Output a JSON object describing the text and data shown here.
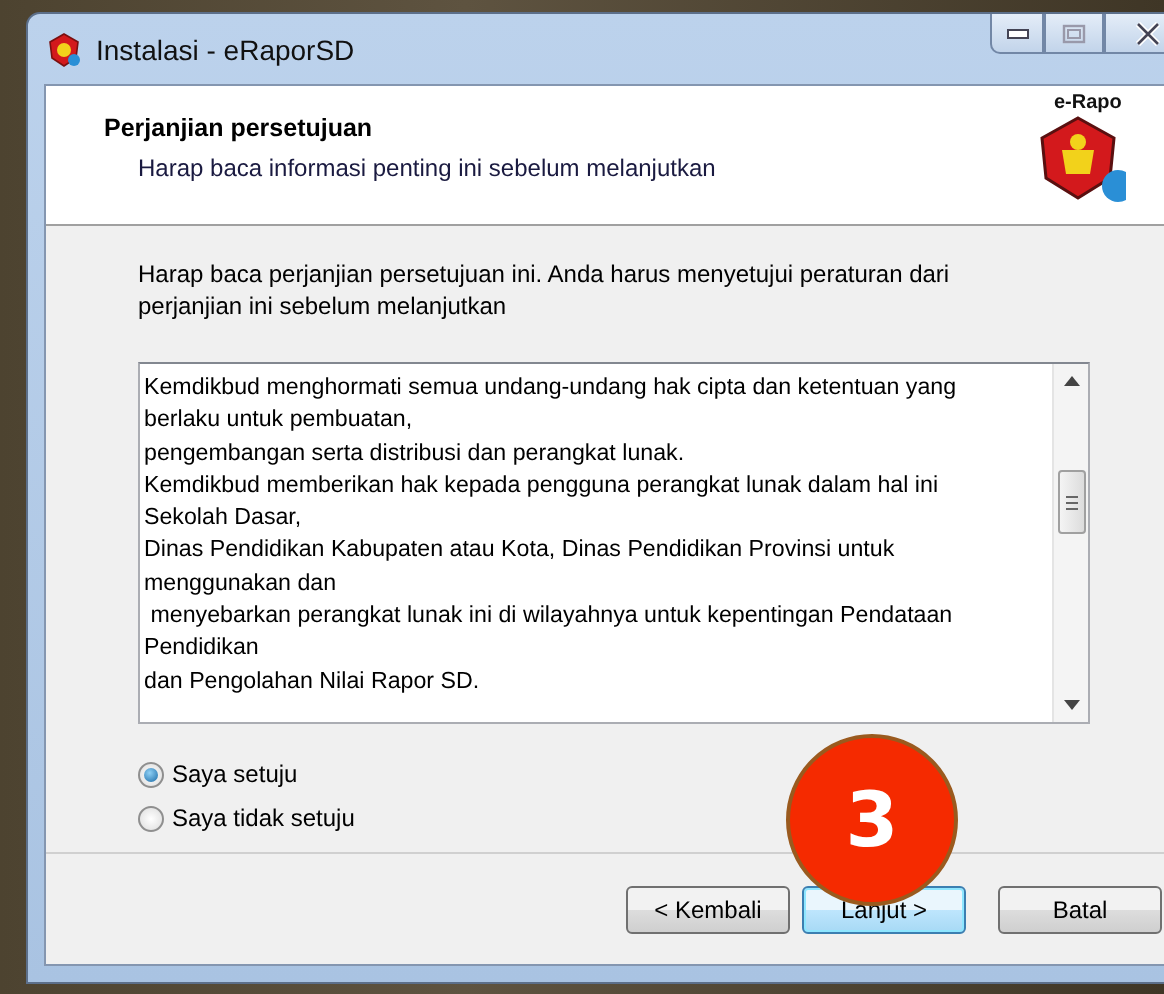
{
  "window": {
    "title": "Instalasi - eRaporSD"
  },
  "header": {
    "title": "Perjanjian persetujuan",
    "subtitle": "Harap baca informasi penting ini sebelum melanjutkan",
    "logo_text": "e-Rapo"
  },
  "instruction": "Harap baca perjanjian persetujuan ini. Anda harus menyetujui peraturan dari perjanjian ini sebelum melanjutkan",
  "license_lines": [
    "Kemdikbud menghormati semua undang-undang hak cipta dan ketentuan yang",
    "berlaku untuk pembuatan,",
    "pengembangan serta distribusi dan perangkat lunak.",
    "Kemdikbud memberikan hak kepada pengguna perangkat lunak dalam hal ini",
    "Sekolah Dasar,",
    "Dinas Pendidikan Kabupaten atau Kota, Dinas Pendidikan Provinsi untuk",
    "menggunakan dan",
    " menyebarkan perangkat lunak ini di wilayahnya untuk kepentingan Pendataan",
    "Pendidikan",
    "dan Pengolahan Nilai Rapor SD."
  ],
  "options": [
    {
      "label": "Saya setuju",
      "selected": true
    },
    {
      "label": "Saya tidak setuju",
      "selected": false
    }
  ],
  "buttons": [
    {
      "label": "< Kembali",
      "focused": false
    },
    {
      "label": "Lanjut >",
      "focused": true
    },
    {
      "label": "Batal",
      "focused": false
    }
  ],
  "annotation": {
    "label": "3"
  }
}
